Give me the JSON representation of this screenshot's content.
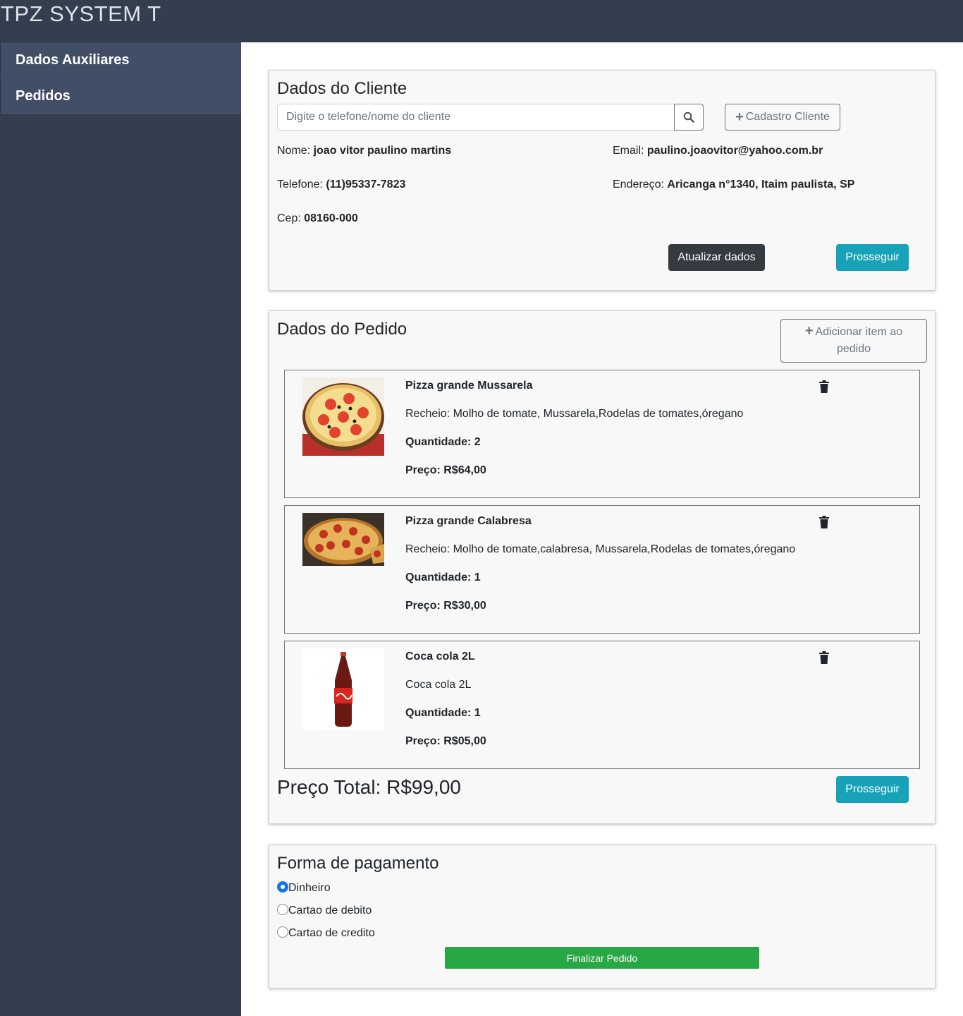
{
  "app": {
    "title": "TPZ SYSTEM T"
  },
  "sidebar": {
    "items": [
      {
        "label": "Dados Auxiliares"
      },
      {
        "label": "Pedidos"
      }
    ]
  },
  "cliente": {
    "title": "Dados do Cliente",
    "search_placeholder": "Digite o telefone/nome do cliente",
    "search_value": "",
    "register_label": "Cadastro Cliente",
    "nome_label": "Nome:",
    "nome": "joao vitor paulino martins",
    "email_label": "Email:",
    "email": "paulino.joaovitor@yahoo.com.br",
    "telefone_label": "Telefone:",
    "telefone": "(11)95337-7823",
    "endereco_label": "Endereço:",
    "endereco": "Aricanga n°1340, Itaim paulista, SP",
    "cep_label": "Cep:",
    "cep": "08160-000",
    "update_label": "Atualizar dados",
    "proceed_label": "Prosseguir"
  },
  "pedido": {
    "title": "Dados do Pedido",
    "add_item_label": "Adicionar item ao pedido",
    "items": [
      {
        "name": "Pizza grande Mussarela",
        "desc": "Recheio: Molho de tomate, Mussarela,Rodelas de tomates,óregano",
        "qty": "Quantidade: 2",
        "price": "Preço: R$64,00"
      },
      {
        "name": "Pizza grande Calabresa",
        "desc": "Recheio: Molho de tomate,calabresa, Mussarela,Rodelas de tomates,óregano",
        "qty": "Quantidade: 1",
        "price": "Preço: R$30,00"
      },
      {
        "name": "Coca cola 2L",
        "desc": "Coca cola 2L",
        "qty": "Quantidade: 1",
        "price": "Preço: R$05,00"
      }
    ],
    "total": "Preço Total: R$99,00",
    "proceed_label": "Prosseguir"
  },
  "pagamento": {
    "title": "Forma de pagamento",
    "options": [
      "Dinheiro",
      "Cartao de debito",
      "Cartao de credito"
    ],
    "selected": "Dinheiro",
    "finish_label": "Finalizar Pedido"
  },
  "colors": {
    "topbar": "#343e4e",
    "sidebar_item": "#414e65",
    "info": "#17a2b8",
    "dark": "#343a40",
    "success": "#28a745"
  }
}
